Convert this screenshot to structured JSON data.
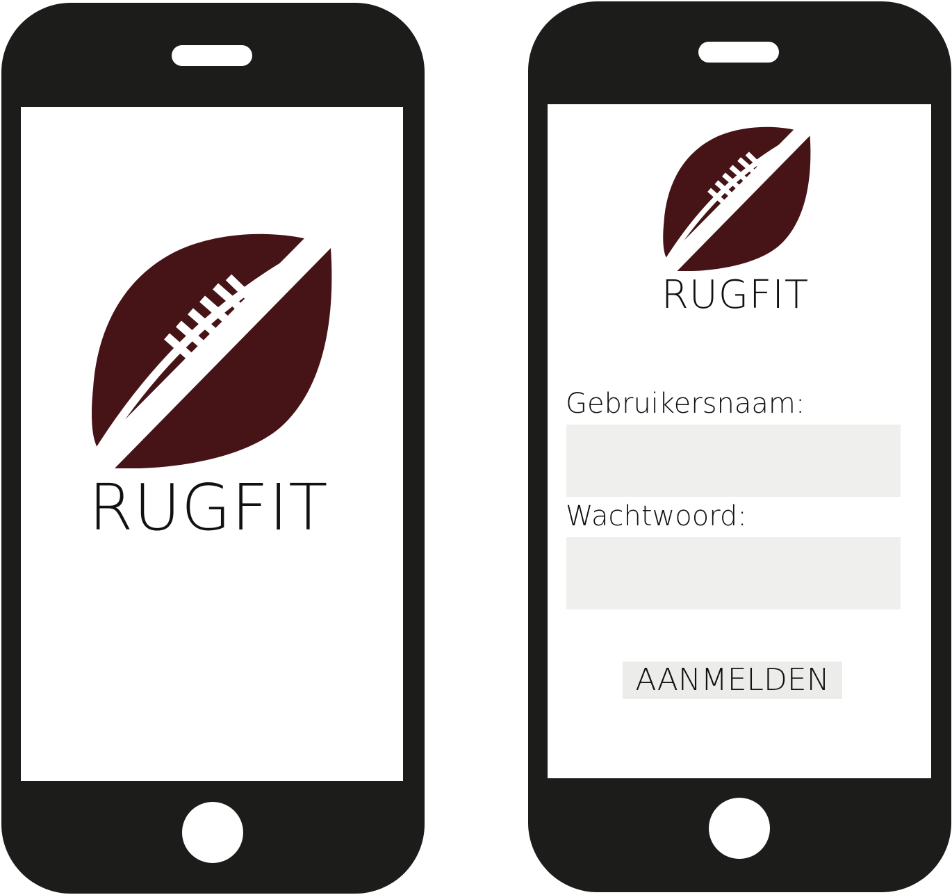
{
  "splash_screen": {
    "brand": "RUGFIT",
    "logo_icon": "rugby-ball-icon",
    "logo_color": "#461316"
  },
  "login_screen": {
    "brand": "RUGFIT",
    "logo_icon": "rugby-ball-icon",
    "username_label": "Gebruikersnaam:",
    "username_value": "",
    "password_label": "Wachtwoord:",
    "password_value": "",
    "login_button_label": "AANMELDEN"
  },
  "colors": {
    "phone_body": "#1c1c1b",
    "field_background": "#efefed",
    "logo": "#461316"
  }
}
